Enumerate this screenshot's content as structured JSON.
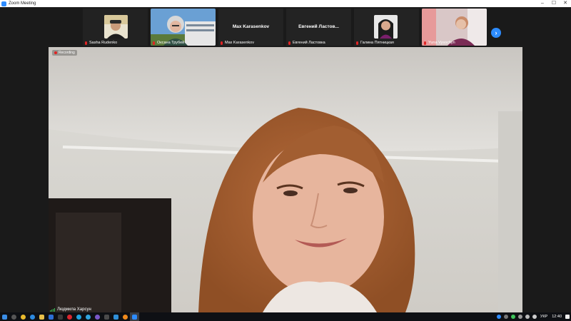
{
  "window": {
    "title": "Zoom Meeting",
    "controls": [
      "–",
      "☐",
      "✕"
    ]
  },
  "gallery": {
    "participants": [
      {
        "name": "Sasha Rudenko",
        "muted": true,
        "video": true
      },
      {
        "name": "Оксана Трубей",
        "muted": true,
        "video": true
      },
      {
        "name": "Max Karasenkov",
        "display_name": "Max Karasenkov",
        "muted": true,
        "video": false
      },
      {
        "name": "Евгений Ластовка",
        "display_name": "Евгений Ластов...",
        "muted": true,
        "video": false
      },
      {
        "name": "Галина Пятницкая",
        "muted": true,
        "video": true
      },
      {
        "name": "Yuna Vysochyn",
        "muted": true,
        "video": true
      }
    ],
    "next_icon": "chevron-right-icon",
    "next_glyph": "›"
  },
  "stage": {
    "recording_label": "Recording",
    "speaker_name": "Людмила Харсун"
  },
  "taskbar": {
    "apps": [
      "windows-start-icon",
      "search-icon",
      "chrome-icon",
      "edge-icon",
      "file-explorer-icon",
      "mail-icon",
      "store-icon",
      "opera-icon",
      "skype-icon",
      "telegram-icon",
      "viber-icon",
      "calculator-icon",
      "photos-icon",
      "vlc-icon",
      "zoom-icon"
    ],
    "tray_lang": "УКР",
    "clock": "12:40"
  },
  "colors": {
    "zoom_blue": "#2d8cff",
    "muted_red": "#e02424",
    "taskbar": "#0e1014"
  }
}
